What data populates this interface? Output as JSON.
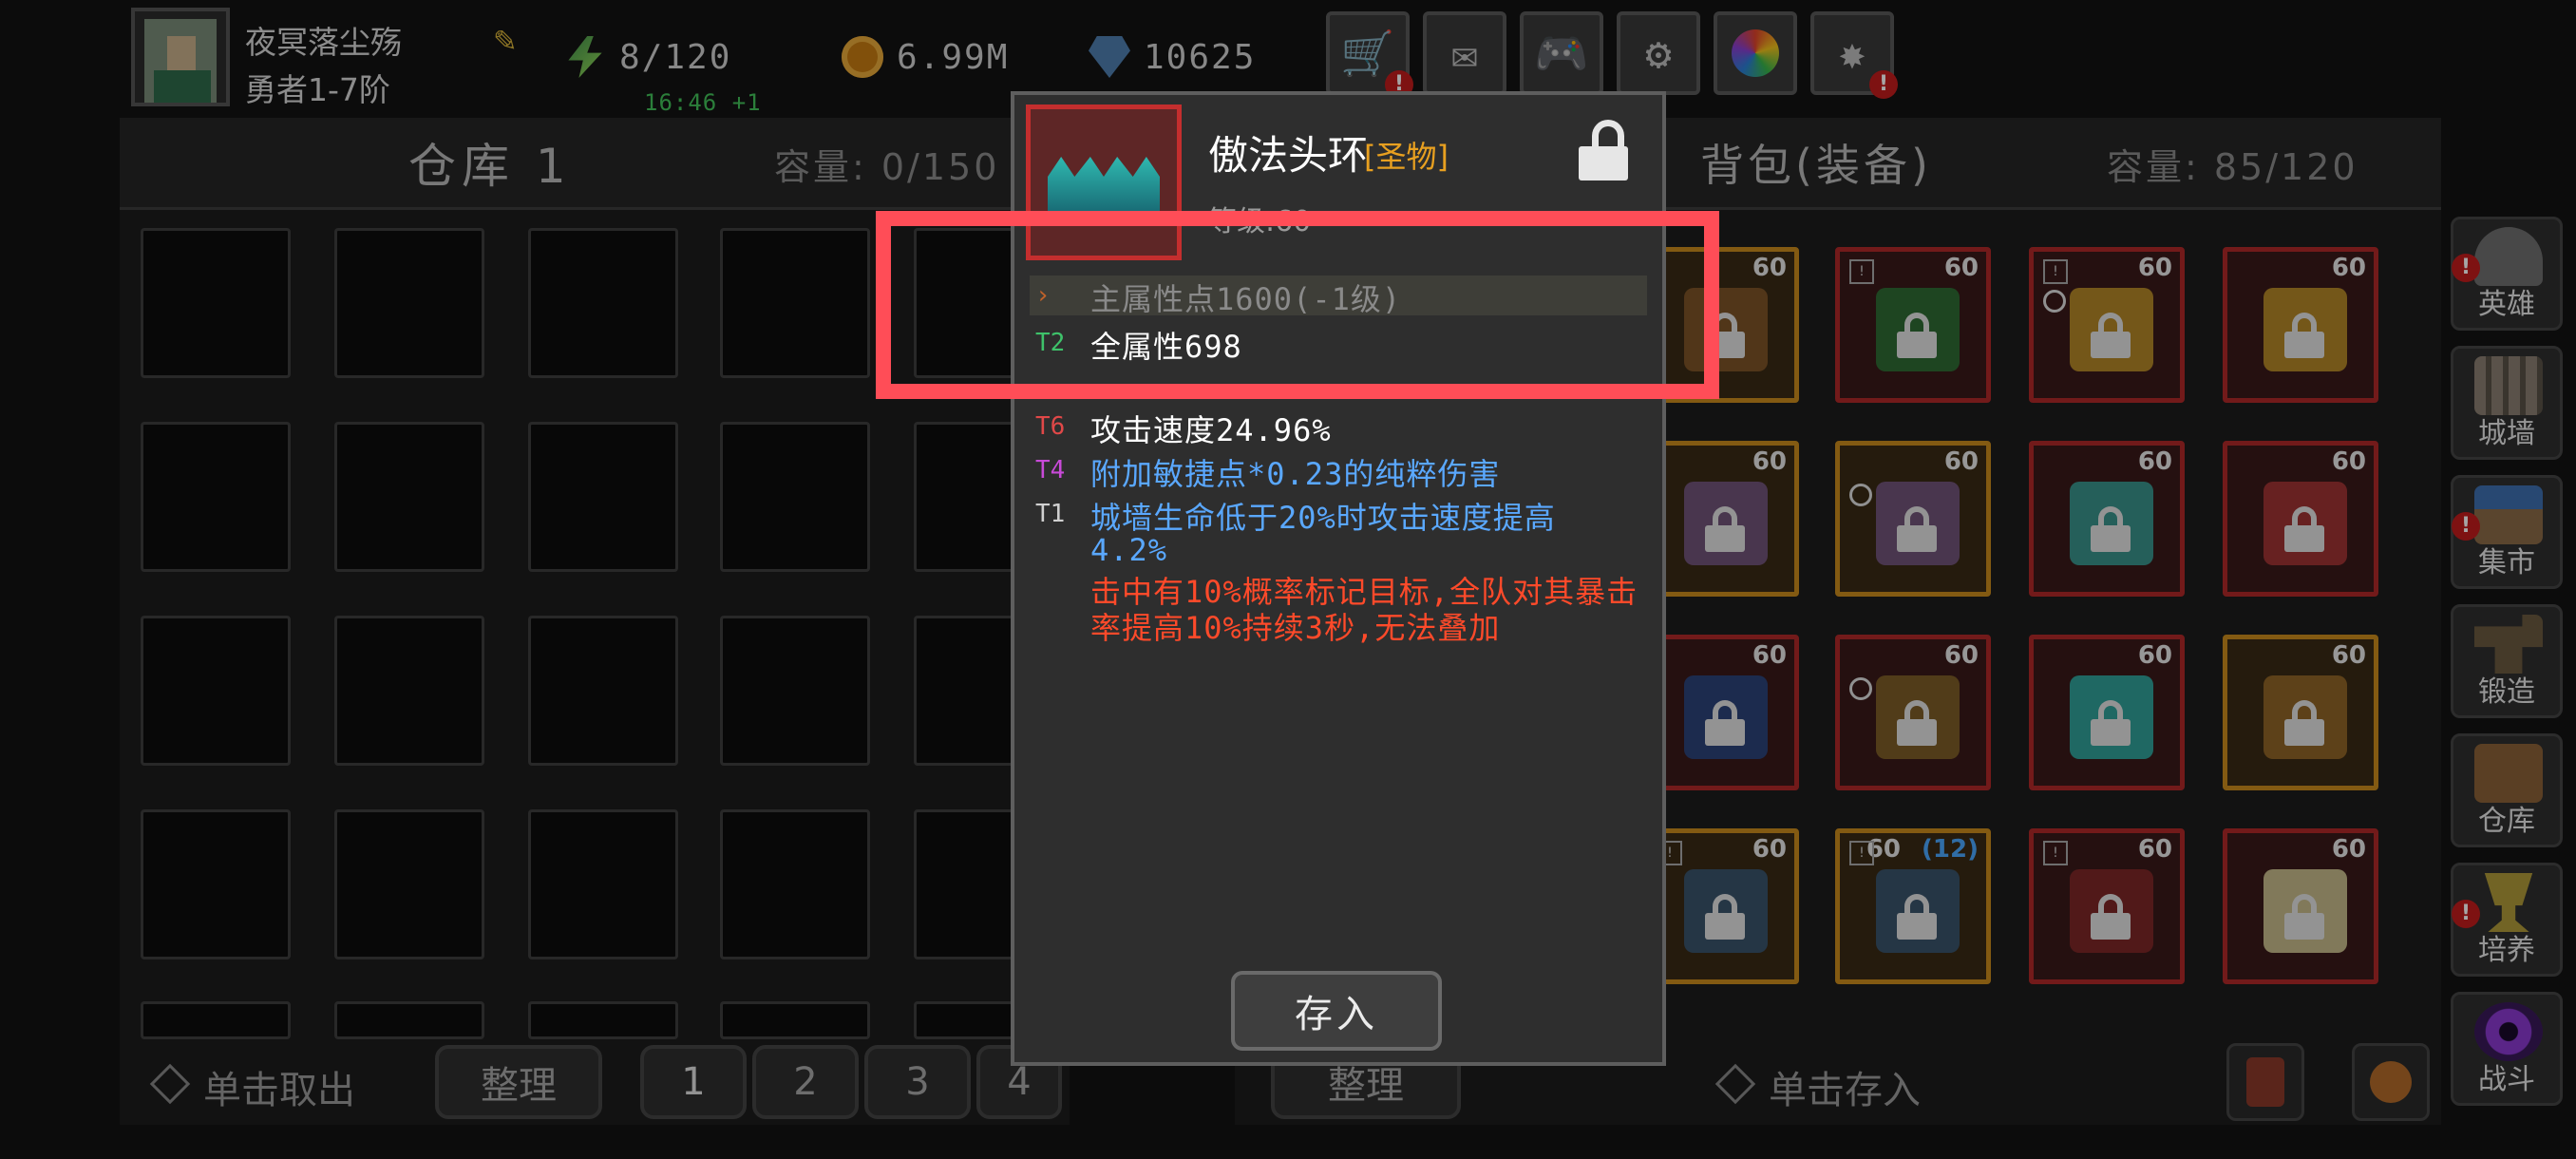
{
  "player": {
    "name": "夜冥落尘殇",
    "rank": "勇者1-7阶"
  },
  "resources": {
    "energy": "8/120",
    "energy_timer": "16:46 +1",
    "gold": "6.99M",
    "gems": "10625"
  },
  "warehouse": {
    "title": "仓库 1",
    "capacity": "容量: 0/150"
  },
  "backpack": {
    "title": "背包(装备)",
    "capacity": "容量:  85/120"
  },
  "item_levels": {
    "lv60": "60",
    "lv60_alt": "60",
    "lv12": "(12)"
  },
  "popup": {
    "name": "傲法头环",
    "tag": "[圣物]",
    "level": "等级:60",
    "stats": [
      {
        "tier": "›",
        "text": "主属性点1600(-1级)",
        "tier_color": "#c0622a",
        "text_color": "#8a8a8a"
      },
      {
        "tier": "T2",
        "text": "全属性698",
        "tier_color": "#3ec26a",
        "text_color": "#ffffff"
      },
      {
        "tier": "T6",
        "text": "攻击速度24.96%",
        "tier_color": "#e04848",
        "text_color": "#ffffff"
      },
      {
        "tier": "T4",
        "text": "附加敏捷点*0.23的纯粹伤害",
        "tier_color": "#c84ad8",
        "text_color": "#5aa8ff"
      },
      {
        "tier": "T1",
        "text": "城墙生命低于20%时攻击速度提高",
        "text2": "4.2%",
        "tier_color": "#d0d0d0",
        "text_color": "#5aa8ff"
      }
    ],
    "special": "击中有10%概率标记目标,全队对其暴击率提高10%持续3秒,无法叠加",
    "special_color": "#ff4a2a",
    "store_button": "存入"
  },
  "sidebar": [
    "英雄",
    "城墙",
    "集市",
    "锻造",
    "仓库",
    "培养",
    "战斗"
  ],
  "bottom_left": {
    "take_out": "单击取出",
    "sort": "整理",
    "pages": [
      "1",
      "2",
      "3",
      "4"
    ]
  },
  "bottom_right": {
    "sort": "整理",
    "store": "单击存入"
  },
  "colors": {
    "highlight_box": "#ff4d57",
    "red_rarity": "#b02828",
    "gold_rarity": "#c98a1c"
  }
}
